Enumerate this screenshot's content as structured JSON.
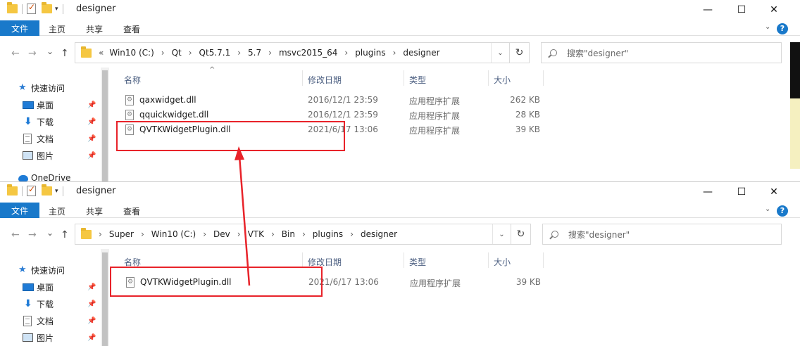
{
  "windows": [
    {
      "title": "designer",
      "ribbon": {
        "file": "文件",
        "home": "主页",
        "share": "共享",
        "view": "查看"
      },
      "nav": {
        "back": "←",
        "forward": "→",
        "recent": "⌄",
        "up": "↑"
      },
      "address": {
        "lead": "«",
        "crumbs": [
          "Win10 (C:)",
          "Qt",
          "Qt5.7.1",
          "5.7",
          "msvc2015_64",
          "plugins",
          "designer"
        ]
      },
      "search_placeholder": "搜索\"designer\"",
      "sidebar": [
        {
          "label": "快速访问",
          "icon": "star-icon",
          "pinned": false
        },
        {
          "label": "桌面",
          "icon": "desktop-icon",
          "pinned": true
        },
        {
          "label": "下载",
          "icon": "download-icon",
          "pinned": true
        },
        {
          "label": "文档",
          "icon": "document-icon",
          "pinned": true
        },
        {
          "label": "图片",
          "icon": "picture-icon",
          "pinned": true
        },
        {
          "label": "OneDrive",
          "icon": "cloud-icon",
          "pinned": false
        }
      ],
      "columns": {
        "name": "名称",
        "date": "修改日期",
        "type": "类型",
        "size": "大小"
      },
      "files": [
        {
          "name": "qaxwidget.dll",
          "date": "2016/12/1 23:59",
          "type": "应用程序扩展",
          "size": "262 KB"
        },
        {
          "name": "qquickwidget.dll",
          "date": "2016/12/1 23:59",
          "type": "应用程序扩展",
          "size": "28 KB"
        },
        {
          "name": "QVTKWidgetPlugin.dll",
          "date": "2021/6/17 13:06",
          "type": "应用程序扩展",
          "size": "39 KB"
        }
      ]
    },
    {
      "title": "designer",
      "ribbon": {
        "file": "文件",
        "home": "主页",
        "share": "共享",
        "view": "查看"
      },
      "nav": {
        "back": "←",
        "forward": "→",
        "recent": "⌄",
        "up": "↑"
      },
      "address": {
        "lead": "",
        "crumbs": [
          "Super",
          "Win10 (C:)",
          "Dev",
          "VTK",
          "Bin",
          "plugins",
          "designer"
        ]
      },
      "search_placeholder": "搜索\"designer\"",
      "sidebar": [
        {
          "label": "快速访问",
          "icon": "star-icon",
          "pinned": false
        },
        {
          "label": "桌面",
          "icon": "desktop-icon",
          "pinned": true
        },
        {
          "label": "下载",
          "icon": "download-icon",
          "pinned": true
        },
        {
          "label": "文档",
          "icon": "document-icon",
          "pinned": true
        },
        {
          "label": "图片",
          "icon": "picture-icon",
          "pinned": true
        }
      ],
      "columns": {
        "name": "名称",
        "date": "修改日期",
        "type": "类型",
        "size": "大小"
      },
      "files": [
        {
          "name": "QVTKWidgetPlugin.dll",
          "date": "2021/6/17 13:06",
          "type": "应用程序扩展",
          "size": "39 KB"
        }
      ]
    }
  ],
  "window_controls": {
    "minimize": "—",
    "maximize": "☐",
    "close": "✕"
  },
  "colors": {
    "accent": "#1979ca",
    "highlight": "#e8232a",
    "header_text": "#4d6082"
  }
}
